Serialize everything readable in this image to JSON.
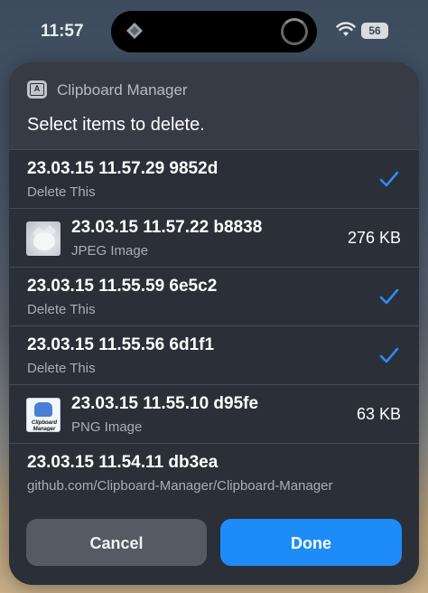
{
  "status_bar": {
    "time": "11:57",
    "battery": "56"
  },
  "sheet": {
    "app_title": "Clipboard Manager",
    "prompt": "Select items to delete.",
    "items": [
      {
        "title": "23.03.15 11.57.29 9852d",
        "subtitle": "Delete This",
        "checked": true
      },
      {
        "title": "23.03.15 11.57.22 b8838",
        "subtitle": "JPEG Image",
        "size": "276 KB"
      },
      {
        "title": "23.03.15 11.55.59 6e5c2",
        "subtitle": "Delete This",
        "checked": true
      },
      {
        "title": "23.03.15 11.55.56 6d1f1",
        "subtitle": "Delete This",
        "checked": true
      },
      {
        "title": "23.03.15 11.55.10 d95fe",
        "subtitle": "PNG Image",
        "size": "63 KB",
        "thumb_text": "Clipboard Manager"
      },
      {
        "title": "23.03.15 11.54.11 db3ea",
        "subtitle": "github.com/Clipboard-Manager/Clipboard-Manager"
      }
    ],
    "buttons": {
      "cancel": "Cancel",
      "done": "Done"
    }
  },
  "colors": {
    "accent": "#1d8cf8",
    "check": "#2d8cf0",
    "sheet_bg": "#2b2f38"
  }
}
